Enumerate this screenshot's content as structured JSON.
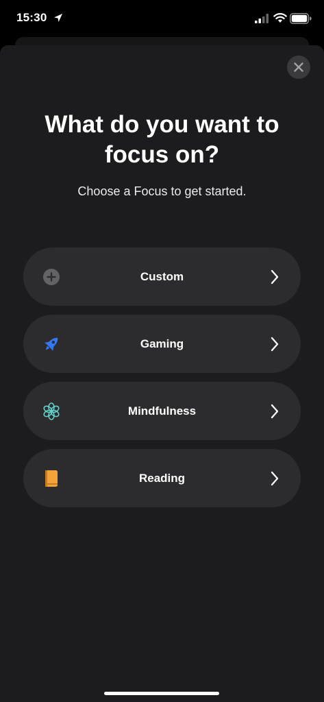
{
  "status_bar": {
    "time": "15:30"
  },
  "sheet": {
    "title": "What do you want to focus on?",
    "subtitle": "Choose a Focus to get started."
  },
  "focus_options": [
    {
      "label": "Custom",
      "icon": "plus-circle-icon",
      "color": "#636366"
    },
    {
      "label": "Gaming",
      "icon": "rocket-icon",
      "color": "#3478f6"
    },
    {
      "label": "Mindfulness",
      "icon": "flower-icon",
      "color": "#63d1c9"
    },
    {
      "label": "Reading",
      "icon": "book-icon",
      "color": "#f2a33a"
    }
  ],
  "colors": {
    "background": "#000000",
    "sheet": "#1c1c1e",
    "row": "#2c2c2e",
    "close_button": "#3a3a3c"
  }
}
